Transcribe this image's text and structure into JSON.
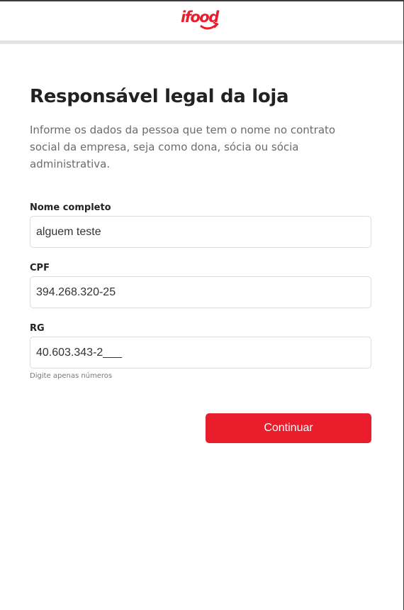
{
  "brand": {
    "logo_text": "ifood",
    "color": "#ea1d2c"
  },
  "page": {
    "title": "Responsável legal da loja",
    "subtitle": "Informe os dados da pessoa que tem o nome no contrato social da empresa, seja como dona, sócia ou sócia administrativa."
  },
  "form": {
    "full_name": {
      "label": "Nome completo",
      "value": "alguem teste"
    },
    "cpf": {
      "label": "CPF",
      "value": "394.268.320-25"
    },
    "rg": {
      "label": "RG",
      "value": "40.603.343-2___",
      "hint": "Digite apenas números"
    },
    "submit_label": "Continuar"
  }
}
